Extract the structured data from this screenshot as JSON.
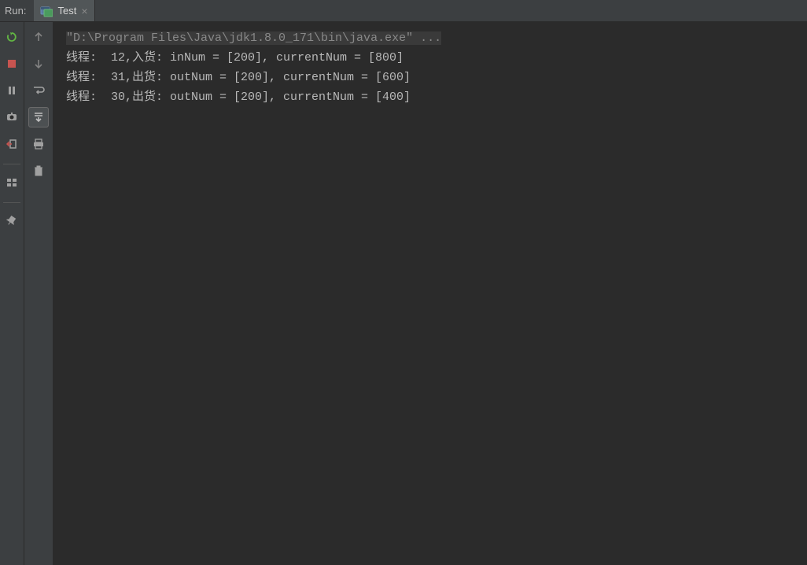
{
  "header": {
    "run_label": "Run:",
    "tab": {
      "label": "Test"
    }
  },
  "console": {
    "cmd": "\"D:\\Program Files\\Java\\jdk1.8.0_171\\bin\\java.exe\" ...",
    "lines": [
      "线程:  12,入货: inNum = [200], currentNum = [800]",
      "线程:  31,出货: outNum = [200], currentNum = [600]",
      "线程:  30,出货: outNum = [200], currentNum = [400]"
    ]
  }
}
